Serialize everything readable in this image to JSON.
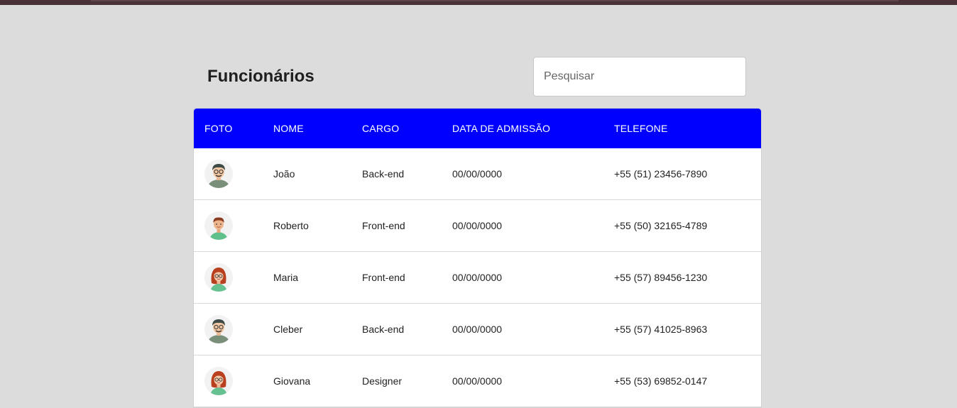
{
  "page": {
    "title": "Funcionários",
    "search_placeholder": "Pesquisar"
  },
  "table": {
    "headers": {
      "foto": "FOTO",
      "nome": "NOME",
      "cargo": "CARGO",
      "data": "DATA DE ADMISSÃO",
      "telefone": "TELEFONE"
    },
    "rows": [
      {
        "nome": "João",
        "cargo": "Back-end",
        "data": "00/00/0000",
        "telefone": "+55 (51) 23456-7890",
        "avatar": "male-glasses-avatar"
      },
      {
        "nome": "Roberto",
        "cargo": "Front-end",
        "data": "00/00/0000",
        "telefone": "+55 (50) 32165-4789",
        "avatar": "male-young-avatar"
      },
      {
        "nome": "Maria",
        "cargo": "Front-end",
        "data": "00/00/0000",
        "telefone": "+55 (57) 89456-1230",
        "avatar": "female-redhead-avatar"
      },
      {
        "nome": "Cleber",
        "cargo": "Back-end",
        "data": "00/00/0000",
        "telefone": "+55 (57) 41025-8963",
        "avatar": "male-glasses-avatar"
      },
      {
        "nome": "Giovana",
        "cargo": "Designer",
        "data": "00/00/0000",
        "telefone": "+55 (53) 69852-0147",
        "avatar": "female-redhead-avatar"
      }
    ]
  },
  "colors": {
    "header_bg": "#0000ff",
    "page_bg": "#dcdcdc",
    "topbar": "#4a3338"
  }
}
